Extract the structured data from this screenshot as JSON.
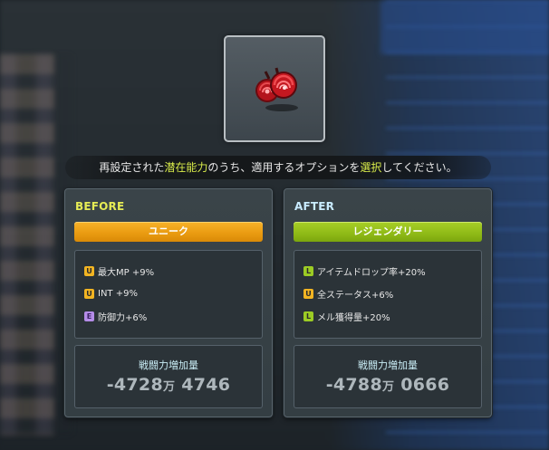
{
  "instruction": {
    "pre": "再設定された",
    "highlight1": "潜在能力",
    "mid": "のうち、適用するオプションを",
    "highlight2": "選択",
    "post": "してください。"
  },
  "item": {
    "icon": "red-rose-earrings-icon"
  },
  "before": {
    "title": "BEFORE",
    "grade": "ユニーク",
    "grade_color": "#e99a10",
    "options": [
      {
        "badge": "U",
        "text": "最大MP +9%"
      },
      {
        "badge": "U",
        "text": "INT +9%"
      },
      {
        "badge": "E",
        "text": "防御力+6%"
      }
    ],
    "power_label": "戦闘力増加量",
    "power_main": "-4728",
    "power_unit": "万",
    "power_rest": " 4746"
  },
  "after": {
    "title": "AFTER",
    "grade": "レジェンダリー",
    "grade_color": "#8fba16",
    "options": [
      {
        "badge": "L",
        "text": "アイテムドロップ率+20%"
      },
      {
        "badge": "U",
        "text": "全ステータス+6%"
      },
      {
        "badge": "L",
        "text": "メル獲得量+20%"
      }
    ],
    "power_label": "戦闘力増加量",
    "power_main": "-4788",
    "power_unit": "万",
    "power_rest": " 0666"
  }
}
